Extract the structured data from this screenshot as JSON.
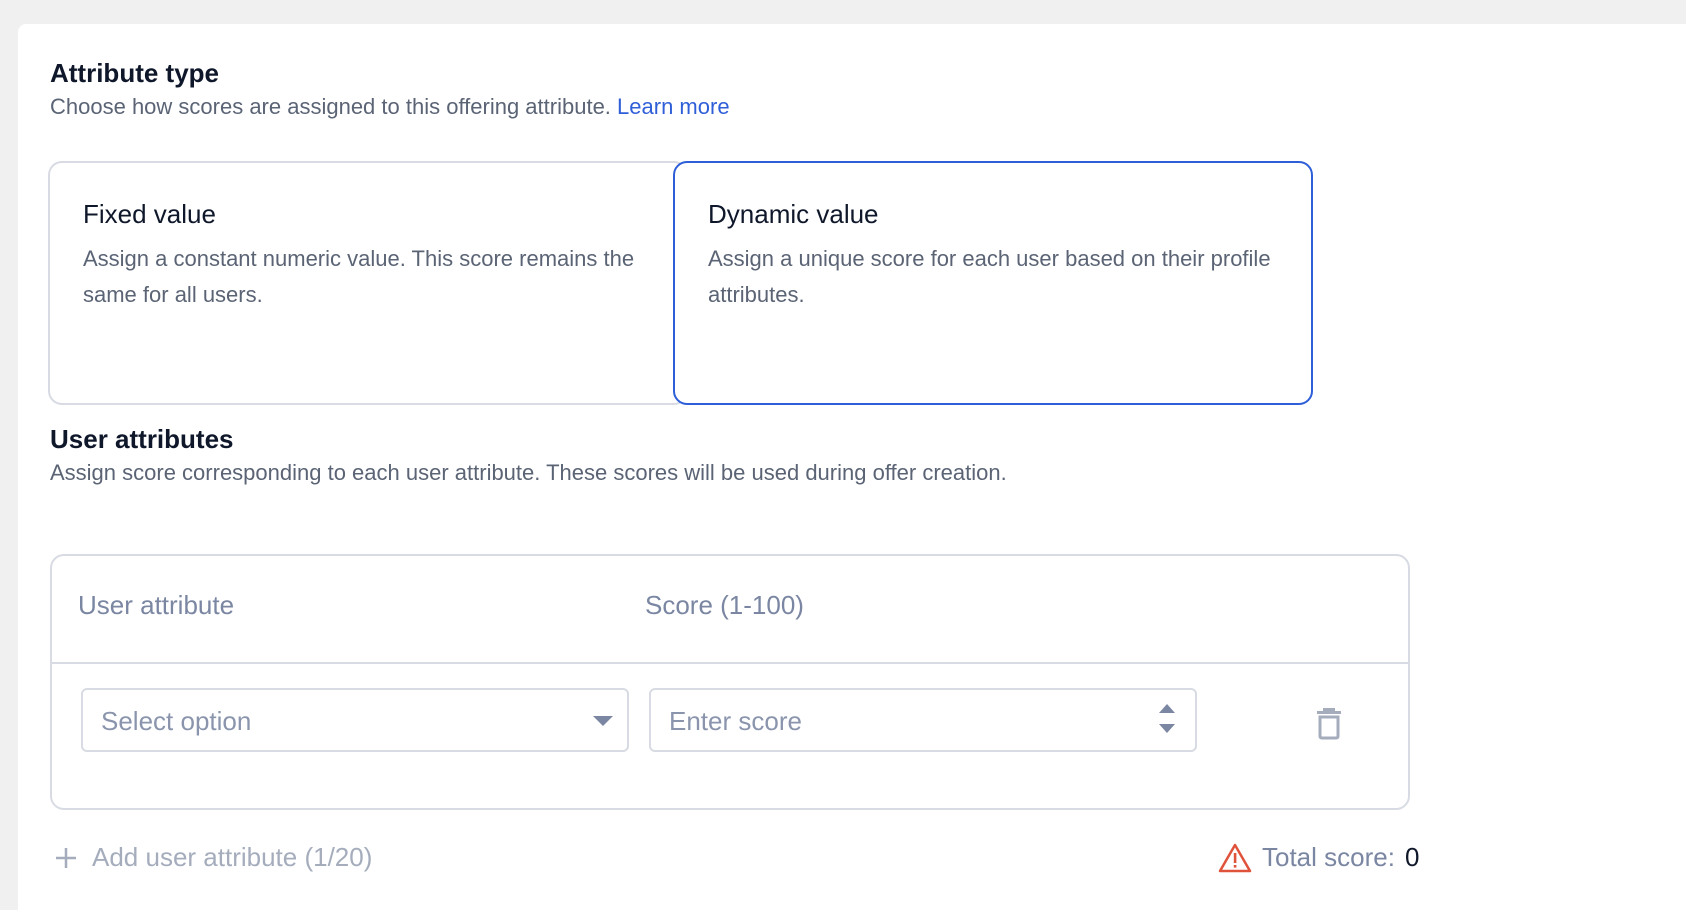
{
  "attribute_type": {
    "title": "Attribute type",
    "description": "Choose how scores are assigned to this offering attribute.",
    "learn_more": "Learn more",
    "options": [
      {
        "title": "Fixed value",
        "description": "Assign a constant numeric value. This score remains the same for all users.",
        "selected": false
      },
      {
        "title": "Dynamic value",
        "description": "Assign a unique score for each user based on their profile attributes.",
        "selected": true
      }
    ]
  },
  "user_attributes": {
    "title": "User attributes",
    "description": "Assign score corresponding to each user attribute. These scores will be used during offer creation.",
    "table": {
      "columns": [
        "User attribute",
        "Score (1-100)"
      ],
      "rows": [
        {
          "attribute_placeholder": "Select option",
          "score_placeholder": "Enter score"
        }
      ]
    },
    "add_button": "Add user attribute (1/20)",
    "total_label": "Total score:",
    "total_value": "0"
  },
  "colors": {
    "accent": "#2f5fd8",
    "warning": "#e0533b",
    "border": "#d8dbe3"
  },
  "icons": {
    "dropdown": "caret-down-icon",
    "spinner": "spinner-arrows-icon",
    "delete": "trash-icon",
    "add": "plus-icon",
    "warning": "warning-triangle-icon"
  }
}
